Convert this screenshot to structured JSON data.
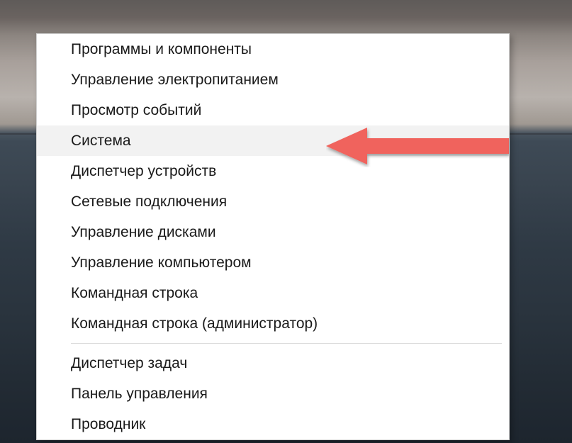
{
  "menu": {
    "items": [
      {
        "label": "Программы и компоненты",
        "highlight": false
      },
      {
        "label": "Управление электропитанием",
        "highlight": false
      },
      {
        "label": "Просмотр событий",
        "highlight": false
      },
      {
        "label": "Система",
        "highlight": true
      },
      {
        "label": "Диспетчер устройств",
        "highlight": false
      },
      {
        "label": "Сетевые подключения",
        "highlight": false
      },
      {
        "label": "Управление дисками",
        "highlight": false
      },
      {
        "label": "Управление компьютером",
        "highlight": false
      },
      {
        "label": "Командная строка",
        "highlight": false
      },
      {
        "label": "Командная строка (администратор)",
        "highlight": false
      }
    ],
    "items2": [
      {
        "label": "Диспетчер задач",
        "highlight": false
      },
      {
        "label": "Панель управления",
        "highlight": false
      },
      {
        "label": "Проводник",
        "highlight": false
      }
    ]
  },
  "annotation": {
    "arrow_color": "#f0645d"
  }
}
